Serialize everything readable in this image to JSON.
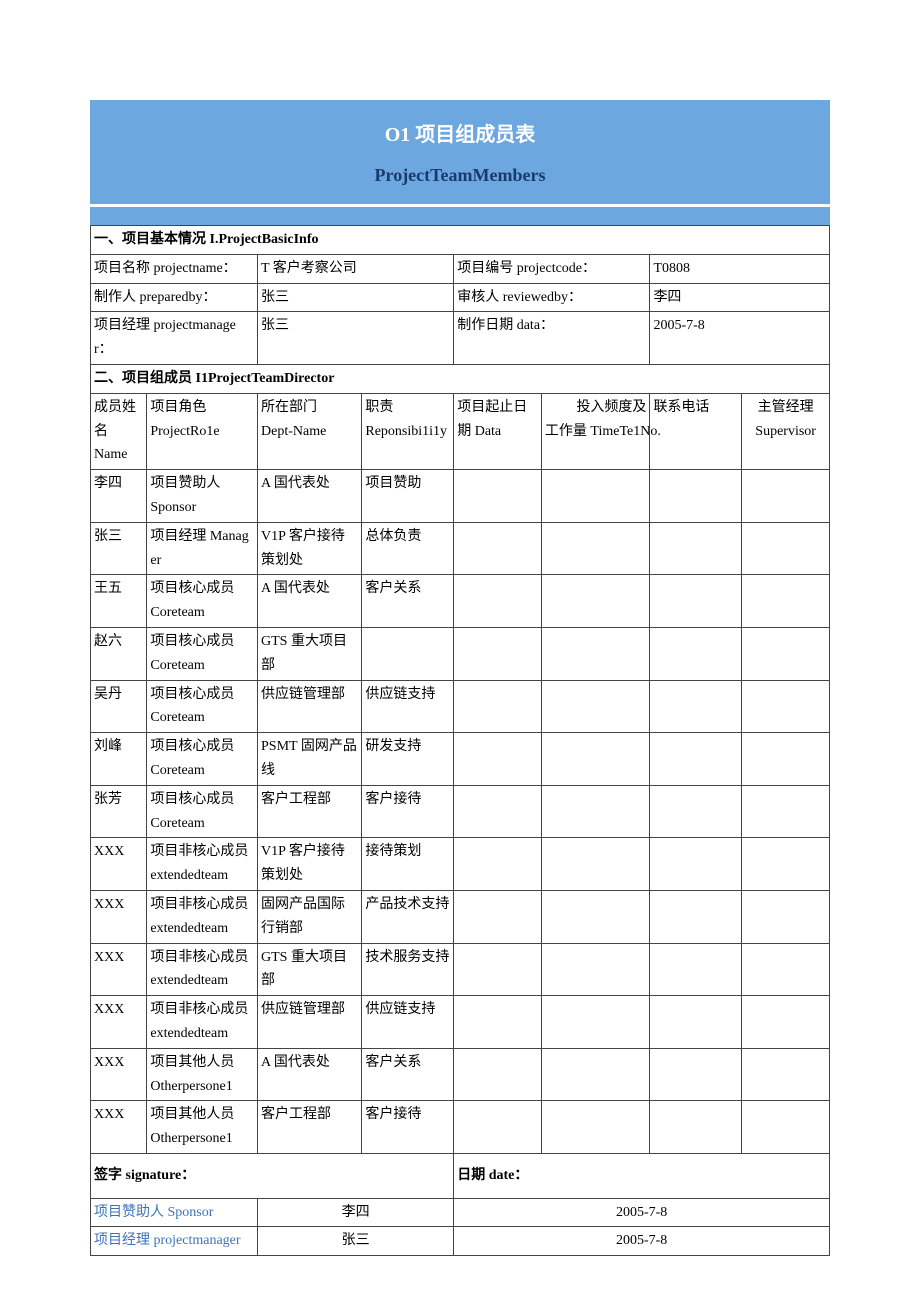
{
  "header": {
    "title_cn": "O1 项目组成员表",
    "title_en": "ProjectTeamMembers"
  },
  "section1": {
    "heading": "一、项目基本情况 I.ProjectBasicInfo",
    "project_name_label": "项目名称 projectname：",
    "project_name_value": "T 客户考察公司",
    "project_code_label": "项目编号 projectcode：",
    "project_code_value": "T0808",
    "prepared_by_label": "制作人 preparedby：",
    "prepared_by_value": "张三",
    "reviewed_by_label": "审核人 reviewedby：",
    "reviewed_by_value": "李四",
    "pm_label": "项目经理 projectmanager：",
    "pm_value": "张三",
    "data_label": "制作日期 data：",
    "data_value": "2005-7-8"
  },
  "section2": {
    "heading": "二、项目组成员 I1ProjectTeamDirector",
    "cols": {
      "name": {
        "l1": "成员姓名",
        "l2": "Name"
      },
      "role": {
        "l1": "项目角色",
        "l2": "ProjectRo1e"
      },
      "dept": {
        "l1": "所在部门",
        "l2": "Dept-Name"
      },
      "resp": {
        "l1": "职责",
        "l2": "Reponsibi1i1y"
      },
      "date": {
        "l1": "项目起止日",
        "l2": "期 Data"
      },
      "time_l1": "投入频度及",
      "time_tel_l2": "工作量 TimeTe1No.",
      "tel": {
        "l1": "联系电话"
      },
      "sup": {
        "l1": "主管经理",
        "l2": "Supervisor"
      }
    },
    "rows": [
      {
        "name": "李四",
        "role_l1": "项目赞助人",
        "role_l2": "Sponsor",
        "dept": "A 国代表处",
        "resp": "项目赞助"
      },
      {
        "name": "张三",
        "role_l1": "项目经理 Manager",
        "role_l2": "",
        "dept": "V1P 客户接待策划处",
        "resp": "总体负责"
      },
      {
        "name": "王五",
        "role_l1": "项目核心成员",
        "role_l2": "Coreteam",
        "dept": "A 国代表处",
        "resp": "客户关系"
      },
      {
        "name": "赵六",
        "role_l1": "项目核心成员",
        "role_l2": "Coreteam",
        "dept": "GTS 重大项目部",
        "resp": ""
      },
      {
        "name": "吴丹",
        "role_l1": "项目核心成员",
        "role_l2": "Coreteam",
        "dept": "供应链管理部",
        "resp": "供应链支持"
      },
      {
        "name": "刘峰",
        "role_l1": "项目核心成员",
        "role_l2": "Coreteam",
        "dept": "PSMT 固网产品线",
        "resp": "研发支持"
      },
      {
        "name": "张芳",
        "role_l1": "项目核心成员",
        "role_l2": "Coreteam",
        "dept": "客户工程部",
        "resp": "客户接待"
      },
      {
        "name": "XXX",
        "role_l1": "项目非核心成员",
        "role_l2": "extendedteam",
        "dept": "V1P 客户接待策划处",
        "resp": "接待策划"
      },
      {
        "name": "XXX",
        "role_l1": "项目非核心成员",
        "role_l2": "extendedteam",
        "dept": "固网产品国际行销部",
        "resp": "产品技术支持"
      },
      {
        "name": "XXX",
        "role_l1": "项目非核心成员",
        "role_l2": "extendedteam",
        "dept": "GTS 重大项目部",
        "resp": "技术服务支持"
      },
      {
        "name": "XXX",
        "role_l1": "项目非核心成员",
        "role_l2": "extendedteam",
        "dept": "供应链管理部",
        "resp": "供应链支持"
      },
      {
        "name": "XXX",
        "role_l1": "项目其他人员",
        "role_l2": "Otherpersone1",
        "dept": "A 国代表处",
        "resp": "客户关系"
      },
      {
        "name": "XXX",
        "role_l1": "项目其他人员",
        "role_l2": "Otherpersone1",
        "dept": "客户工程部",
        "resp": "客户接待"
      }
    ]
  },
  "signature": {
    "sig_label": "签字 signature：",
    "date_label": "日期 date：",
    "sponsor_label": "项目赞助人 Sponsor",
    "sponsor_name": "李四",
    "sponsor_date": "2005-7-8",
    "pm_label": "项目经理 projectmanager",
    "pm_name": "张三",
    "pm_date": "2005-7-8"
  }
}
